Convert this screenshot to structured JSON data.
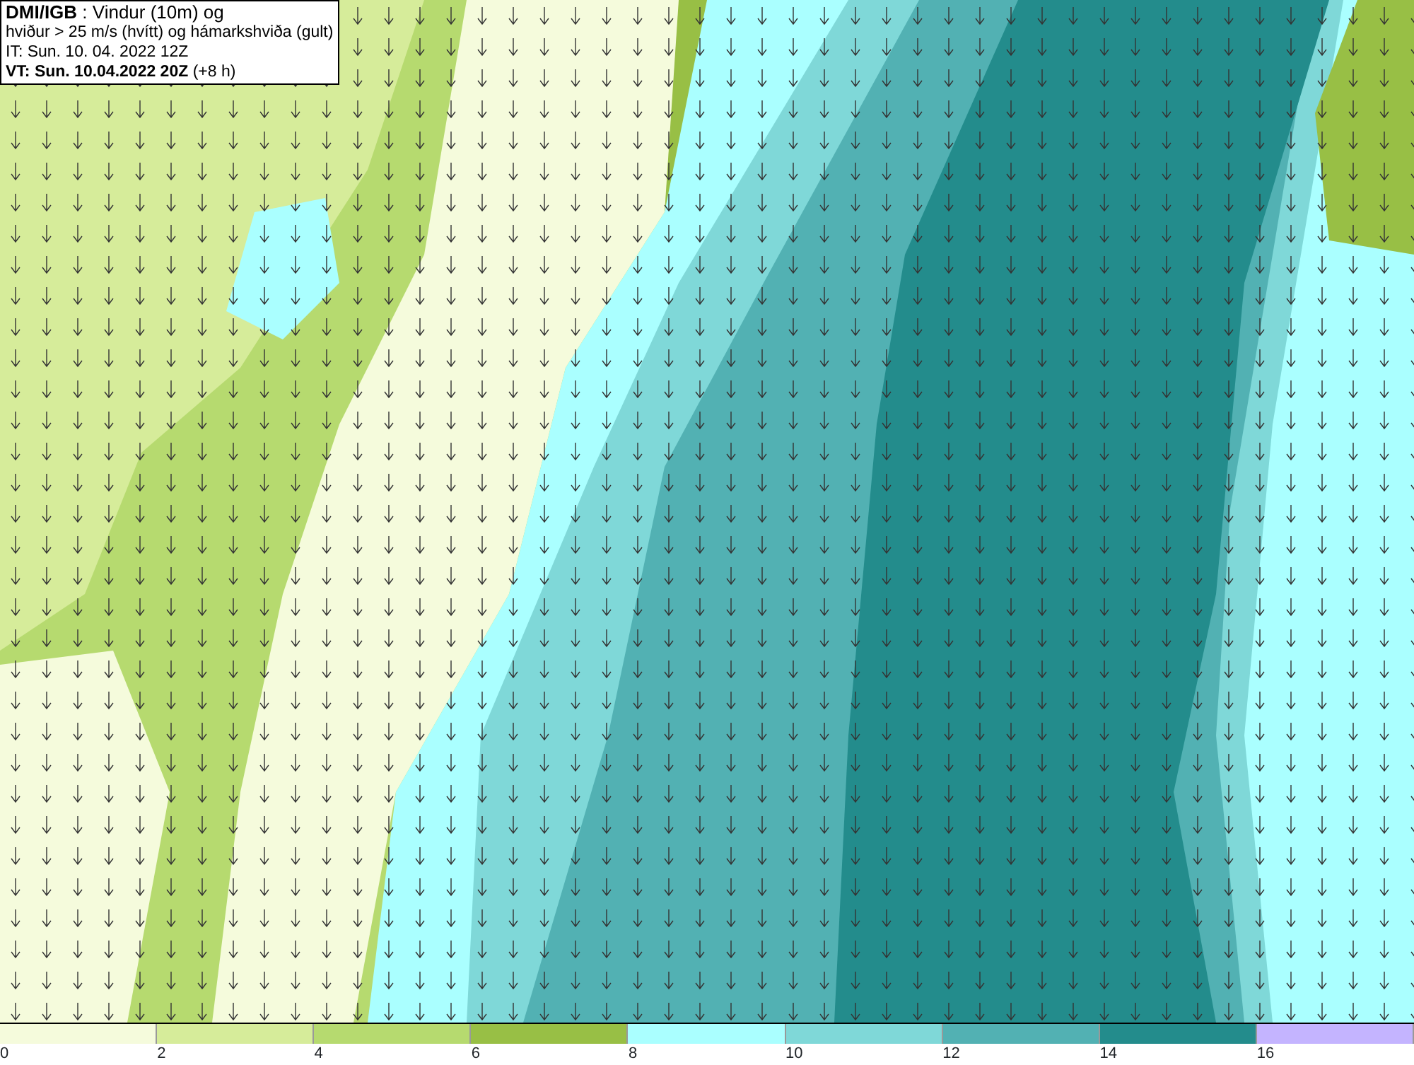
{
  "header": {
    "lines": [
      "**DMI/IGB** : Vindur (10m) og",
      "hviður > 25 m/s (hvítt) og hámarkshviða (gult)",
      "IT: Sun. 10. 04. 2022 12Z",
      "**VT: Sun. 10.04.2022 20Z** (+8 h)"
    ]
  },
  "legend": [
    {
      "label": "0",
      "color": "#f5fbdc"
    },
    {
      "label": "2",
      "color": "#d6ec9a"
    },
    {
      "label": "4",
      "color": "#b6da6f"
    },
    {
      "label": "6",
      "color": "#98bf45"
    },
    {
      "label": "8",
      "color": "#aaffff"
    },
    {
      "label": "10",
      "color": "#7fd8d8"
    },
    {
      "label": "12",
      "color": "#52b1b3"
    },
    {
      "label": "14",
      "color": "#238c8c"
    },
    {
      "label": "16",
      "color": "#c4b4ff"
    }
  ]
}
